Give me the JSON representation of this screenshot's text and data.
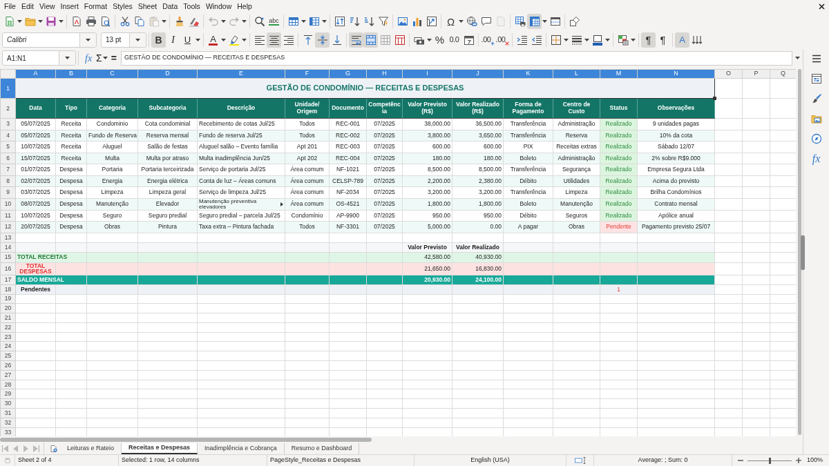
{
  "menu": [
    "File",
    "Edit",
    "View",
    "Insert",
    "Format",
    "Styles",
    "Sheet",
    "Data",
    "Tools",
    "Window",
    "Help"
  ],
  "standard_toolbar": [
    [
      {
        "kind": "new",
        "dropdown": true,
        "pressed": false,
        "disabled": false
      },
      {
        "kind": "open",
        "dropdown": true,
        "pressed": false,
        "disabled": false
      },
      {
        "kind": "save",
        "dropdown": true,
        "pressed": false,
        "disabled": false
      }
    ],
    [
      {
        "kind": "pdf",
        "pressed": false,
        "disabled": false
      },
      {
        "kind": "print",
        "pressed": false,
        "disabled": false
      },
      {
        "kind": "preview",
        "pressed": false,
        "disabled": false
      }
    ],
    [
      {
        "kind": "cut",
        "pressed": false,
        "disabled": false
      },
      {
        "kind": "copy",
        "pressed": false,
        "disabled": false
      },
      {
        "kind": "paste",
        "dropdown": true,
        "pressed": false,
        "disabled": true
      }
    ],
    [
      {
        "kind": "clone",
        "pressed": false,
        "disabled": false
      },
      {
        "kind": "clear",
        "pressed": false,
        "disabled": false
      }
    ],
    [
      {
        "kind": "undo",
        "dropdown": true,
        "pressed": false,
        "disabled": true
      },
      {
        "kind": "redo",
        "dropdown": true,
        "pressed": false,
        "disabled": true
      }
    ],
    [
      {
        "kind": "find",
        "pressed": false,
        "disabled": false
      },
      {
        "kind": "spelling",
        "label": "abc",
        "pressed": false,
        "disabled": false
      }
    ],
    [
      {
        "kind": "row",
        "dropdown": true,
        "pressed": false,
        "disabled": false
      },
      {
        "kind": "column",
        "dropdown": true,
        "pressed": false,
        "disabled": false
      }
    ],
    [
      {
        "kind": "sort",
        "pressed": false,
        "disabled": false
      },
      {
        "kind": "sort_asc",
        "pressed": false,
        "disabled": false
      },
      {
        "kind": "sort_desc",
        "pressed": false,
        "disabled": false
      },
      {
        "kind": "filter",
        "pressed": false,
        "disabled": false
      }
    ],
    [
      {
        "kind": "image",
        "pressed": false,
        "disabled": false
      },
      {
        "kind": "chart",
        "pressed": false,
        "disabled": false
      },
      {
        "kind": "pivot",
        "pressed": false,
        "disabled": false
      }
    ],
    [
      {
        "kind": "special",
        "label": "Ω",
        "dropdown": true,
        "pressed": false,
        "disabled": false
      },
      {
        "kind": "hyperlink",
        "pressed": false,
        "disabled": false
      },
      {
        "kind": "comment",
        "pressed": false,
        "disabled": false
      },
      {
        "kind": "headerfooter",
        "pressed": false,
        "disabled": true
      }
    ],
    [
      {
        "kind": "printarea",
        "pressed": false,
        "disabled": false
      },
      {
        "kind": "freeze",
        "dropdown": true,
        "pressed": true,
        "disabled": false
      },
      {
        "kind": "split",
        "pressed": false,
        "disabled": false
      }
    ],
    [
      {
        "kind": "shapes",
        "pressed": false,
        "disabled": false
      }
    ]
  ],
  "formatting_toolbar": {
    "font_name": "Calibri",
    "font_size": "13 pt",
    "groups": [
      [
        {
          "kind": "bold",
          "label": "B",
          "pressed": true,
          "disabled": false
        },
        {
          "kind": "italic",
          "label": "I",
          "pressed": false,
          "disabled": false
        },
        {
          "kind": "underline",
          "label": "U",
          "dropdown": true,
          "pressed": false,
          "disabled": false
        }
      ],
      [
        {
          "kind": "font_color",
          "label": "A",
          "dropdown": true,
          "pressed": false,
          "disabled": false
        },
        {
          "kind": "highlight",
          "dropdown": true,
          "pressed": false,
          "disabled": false
        }
      ],
      [
        {
          "kind": "align_left",
          "pressed": false,
          "disabled": false
        },
        {
          "kind": "align_center",
          "pressed": true,
          "disabled": false
        },
        {
          "kind": "align_right",
          "pressed": false,
          "disabled": false
        }
      ],
      [
        {
          "kind": "valign_top",
          "pressed": false,
          "disabled": false
        },
        {
          "kind": "valign_middle",
          "pressed": true,
          "disabled": false
        },
        {
          "kind": "valign_bottom",
          "pressed": false,
          "disabled": false
        }
      ],
      [
        {
          "kind": "wrap",
          "pressed": true,
          "disabled": false
        },
        {
          "kind": "merge_center",
          "pressed": true,
          "disabled": false
        },
        {
          "kind": "unmerge",
          "pressed": false,
          "disabled": false
        },
        {
          "kind": "merge_cells",
          "pressed": false,
          "disabled": false
        }
      ],
      [
        {
          "kind": "currency",
          "dropdown": true,
          "pressed": false,
          "disabled": false
        },
        {
          "kind": "percent",
          "label": "%",
          "pressed": false,
          "disabled": false
        },
        {
          "kind": "number",
          "label": "0.0",
          "pressed": false,
          "disabled": false
        },
        {
          "kind": "date",
          "pressed": false,
          "disabled": false
        }
      ],
      [
        {
          "kind": "add_decimal",
          "label": ".00",
          "pressed": false,
          "disabled": false
        },
        {
          "kind": "delete_decimal",
          "label": ".00",
          "pressed": false,
          "disabled": false
        }
      ],
      [
        {
          "kind": "indent_more",
          "pressed": false,
          "disabled": false
        },
        {
          "kind": "indent_less",
          "pressed": false,
          "disabled": false
        }
      ],
      [
        {
          "kind": "borders",
          "dropdown": true,
          "pressed": false,
          "disabled": false
        },
        {
          "kind": "border_style",
          "dropdown": true,
          "pressed": false,
          "disabled": false
        },
        {
          "kind": "border_color",
          "dropdown": true,
          "pressed": false,
          "disabled": false
        }
      ],
      [
        {
          "kind": "conditional",
          "dropdown": true,
          "pressed": false,
          "disabled": false
        }
      ],
      [
        {
          "kind": "ltr",
          "label": "¶",
          "pressed": true,
          "disabled": false
        },
        {
          "kind": "rtl",
          "label": "¶",
          "pressed": false,
          "disabled": false
        }
      ],
      [
        {
          "kind": "text_direction",
          "label": "A",
          "pressed": true,
          "disabled": false
        },
        {
          "kind": "stacked",
          "pressed": false,
          "disabled": false
        }
      ]
    ]
  },
  "formula_bar": {
    "name_box": "A1:N1",
    "wizard": "fx",
    "sum": "Σ",
    "equals": "=",
    "content": "GESTÃO DE CONDOMÍNIO — RECEITAS E DESPESAS"
  },
  "sheet": {
    "columns": [
      {
        "label": "A",
        "selected": true
      },
      {
        "label": "B",
        "selected": true
      },
      {
        "label": "C",
        "selected": true
      },
      {
        "label": "D",
        "selected": true
      },
      {
        "label": "E",
        "selected": true
      },
      {
        "label": "F",
        "selected": true
      },
      {
        "label": "G",
        "selected": true
      },
      {
        "label": "H",
        "selected": true
      },
      {
        "label": "I",
        "selected": true
      },
      {
        "label": "J",
        "selected": true
      },
      {
        "label": "K",
        "selected": true
      },
      {
        "label": "L",
        "selected": true
      },
      {
        "label": "M",
        "selected": true
      },
      {
        "label": "N",
        "selected": true
      },
      {
        "label": "O",
        "selected": false
      },
      {
        "label": "P",
        "selected": false
      },
      {
        "label": "Q",
        "selected": false
      }
    ],
    "row_numbers": [
      {
        "label": "1",
        "selected": true
      },
      {
        "label": "2",
        "selected": false
      },
      {
        "label": "3",
        "selected": false
      },
      {
        "label": "4",
        "selected": false
      },
      {
        "label": "5",
        "selected": false
      },
      {
        "label": "6",
        "selected": false
      },
      {
        "label": "7",
        "selected": false
      },
      {
        "label": "8",
        "selected": false
      },
      {
        "label": "9",
        "selected": false
      },
      {
        "label": "10",
        "selected": false
      },
      {
        "label": "11",
        "selected": false
      },
      {
        "label": "12",
        "selected": false
      },
      {
        "label": "13",
        "selected": false
      },
      {
        "label": "14",
        "selected": false
      },
      {
        "label": "15",
        "selected": false
      },
      {
        "label": "16",
        "selected": false
      },
      {
        "label": "17",
        "selected": false
      },
      {
        "label": "18",
        "selected": false
      },
      {
        "label": "19",
        "selected": false
      },
      {
        "label": "20",
        "selected": false
      },
      {
        "label": "21",
        "selected": false
      },
      {
        "label": "22",
        "selected": false
      },
      {
        "label": "23",
        "selected": false
      },
      {
        "label": "24",
        "selected": false
      },
      {
        "label": "25",
        "selected": false
      },
      {
        "label": "26",
        "selected": false
      },
      {
        "label": "27",
        "selected": false
      },
      {
        "label": "28",
        "selected": false
      },
      {
        "label": "29",
        "selected": false
      },
      {
        "label": "30",
        "selected": false
      },
      {
        "label": "31",
        "selected": false
      },
      {
        "label": "32",
        "selected": false
      },
      {
        "label": "33",
        "selected": false
      }
    ],
    "title": {
      "text": "GESTÃO DE CONDOMÍNIO — RECEITAS E DESPESAS",
      "selected": true
    },
    "headers": [
      "Data",
      "Tipo",
      "Categoria",
      "Subcategoria",
      "Descrição",
      "Unidade/ Origem",
      "Documento",
      "Competência",
      "Valor Previsto (R$)",
      "Valor Realizado (R$)",
      "Forma de Pagamento",
      "Centro de Custo",
      "Status",
      "Observações"
    ],
    "rows": [
      {
        "cells": [
          "05/07/2025",
          "Receita",
          "Condominio",
          "Cota condominial",
          "Recebimento de cotas Jul/25",
          "Todos",
          "REC-001",
          "07/2025",
          "38,000.00",
          "36,500.00",
          "Transferência",
          "Administração",
          "Realizado",
          "9 unidades pagas"
        ],
        "completed": true,
        "clipped": false
      },
      {
        "cells": [
          "05/07/2025",
          "Receita",
          "Fundo de Reserva",
          "Reserva mensal",
          "Fundo de reserva Jul/25",
          "Todos",
          "REC-002",
          "07/2025",
          "3,800.00",
          "3,650.00",
          "Transferência",
          "Reserva",
          "Realizado",
          "10% da cota"
        ],
        "completed": true,
        "clipped": false
      },
      {
        "cells": [
          "10/07/2025",
          "Receita",
          "Aluguel",
          "Salão de festas",
          "Aluguel salão – Evento família",
          "Apt 201",
          "REC-003",
          "07/2025",
          "600.00",
          "600.00",
          "PIX",
          "Receitas extras",
          "Realizado",
          "Sábado 12/07"
        ],
        "completed": true,
        "clipped": false
      },
      {
        "cells": [
          "15/07/2025",
          "Receita",
          "Multa",
          "Multa por atraso",
          "Multa inadimplência Jun/25",
          "Apt 202",
          "REC-004",
          "07/2025",
          "180.00",
          "180.00",
          "Boleto",
          "Administração",
          "Realizado",
          "2% sobre R$9.000"
        ],
        "completed": true,
        "clipped": false
      },
      {
        "cells": [
          "01/07/2025",
          "Despesa",
          "Portaria",
          "Portaria terceirizada",
          "Serviço de portaria Jul/25",
          "Área comum",
          "NF-1021",
          "07/2025",
          "8,500.00",
          "8,500.00",
          "Transferência",
          "Segurança",
          "Realizado",
          "Empresa Segura Ltda"
        ],
        "completed": true,
        "clipped": false
      },
      {
        "cells": [
          "02/07/2025",
          "Despesa",
          "Energia",
          "Energia elétrica",
          "Conta de luz – Áreas comuns",
          "Área comum",
          "CELSP-789",
          "07/2025",
          "2,200.00",
          "2,380.00",
          "Débito",
          "Utilidades",
          "Realizado",
          "Acima do previsto"
        ],
        "completed": true,
        "clipped": false
      },
      {
        "cells": [
          "03/07/2025",
          "Despesa",
          "Limpeza",
          "Limpeza geral",
          "Serviço de limpeza Jul/25",
          "Área comum",
          "NF-2034",
          "07/2025",
          "3,200.00",
          "3,200.00",
          "Transferência",
          "Limpeza",
          "Realizado",
          "Brilha Condomínios"
        ],
        "completed": true,
        "clipped": false
      },
      {
        "cells": [
          "08/07/2025",
          "Despesa",
          "Manutenção",
          "Elevador",
          "Manutenção preventiva elevadores",
          "Área comum",
          "OS-4521",
          "07/2025",
          "1,800.00",
          "1,800.00",
          "Boleto",
          "Manutenção",
          "Realizado",
          "Contrato mensal"
        ],
        "completed": true,
        "clipped": true
      },
      {
        "cells": [
          "10/07/2025",
          "Despesa",
          "Seguro",
          "Seguro predial",
          "Seguro predial – parcela Jul/25",
          "Condomínio",
          "AP-9900",
          "07/2025",
          "950.00",
          "950.00",
          "Débito",
          "Seguros",
          "Realizado",
          "Apólice anual"
        ],
        "completed": true,
        "clipped": false
      },
      {
        "cells": [
          "20/07/2025",
          "Despesa",
          "Obras",
          "Pintura",
          "Taxa extra – Pintura fachada",
          "Todos",
          "NF-3301",
          "07/2025",
          "5,000.00",
          "0.00",
          "A pagar",
          "Obras",
          "Pendente",
          "Pagamento previsto 25/07"
        ],
        "completed": false,
        "clipped": false
      }
    ],
    "summary_heading": [
      "Valor Previsto",
      "Valor Realizado"
    ],
    "totals": [
      {
        "kind": "income",
        "label": "TOTAL RECEITAS",
        "previsto": "42,580.00",
        "realizado": "40,930.00"
      },
      {
        "kind": "expense",
        "label": "TOTAL DESPESAS",
        "previsto": "21,650.00",
        "realizado": "16,830.00"
      },
      {
        "kind": "balance",
        "label": "SALDO MENSAL",
        "previsto": "20,930.00",
        "realizado": "24,100.00"
      }
    ],
    "pending": {
      "label": "Pendentes",
      "count": "1"
    }
  },
  "sidebar": [
    {
      "kind": "menu"
    },
    {
      "kind": "properties"
    },
    {
      "kind": "styles"
    },
    {
      "kind": "gallery"
    },
    {
      "kind": "navigator"
    },
    {
      "kind": "functions",
      "label": "fx"
    }
  ],
  "sheet_tabs": {
    "navigation": [
      {
        "kind": "first",
        "disabled": true
      },
      {
        "kind": "previous",
        "disabled": true
      },
      {
        "kind": "next",
        "disabled": true
      },
      {
        "kind": "last",
        "disabled": true
      }
    ],
    "tabs": [
      {
        "label": "Leituras e Rateio",
        "selected": false
      },
      {
        "label": "Receitas e Despesas",
        "selected": true
      },
      {
        "label": "Inadimplência e Cobrança",
        "selected": false
      },
      {
        "label": "Resumo e Dashboard",
        "selected": false
      }
    ]
  },
  "status_bar": {
    "sheet": "Sheet 2 of 4",
    "selection": "Selected: 1 row, 14 columns",
    "page_style": "PageStyle_Receitas e Despesas",
    "language": "English (USA)",
    "statistics": "Average: ; Sum: 0",
    "zoom_slider": {
      "level": 0.5
    },
    "zoom": "100%"
  }
}
